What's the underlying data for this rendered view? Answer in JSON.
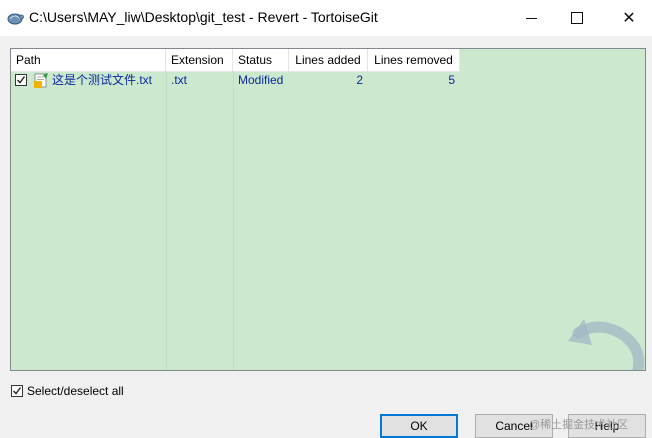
{
  "window": {
    "title": "C:\\Users\\MAY_liw\\Desktop\\git_test - Revert - TortoiseGit",
    "minimize_glyph": "",
    "maximize_glyph": "",
    "close_glyph": "✕"
  },
  "list": {
    "columns": [
      "Path",
      "Extension",
      "Status",
      "Lines added",
      "Lines removed"
    ],
    "rows": [
      {
        "checked": true,
        "path": "这是个测试文件.txt",
        "extension": ".txt",
        "status": "Modified",
        "lines_added": "2",
        "lines_removed": "5",
        "icon": "modified-text-file-icon"
      }
    ]
  },
  "select_all": {
    "label": "Select/deselect all",
    "checked": true
  },
  "buttons": {
    "ok": "OK",
    "cancel": "Cancel",
    "help": "Help"
  },
  "watermark_text": "@稀土掘金技术社区",
  "colors": {
    "list_bg": "#cce8cf",
    "item_text": "#0a2a9c",
    "focus_border": "#0078d7"
  }
}
